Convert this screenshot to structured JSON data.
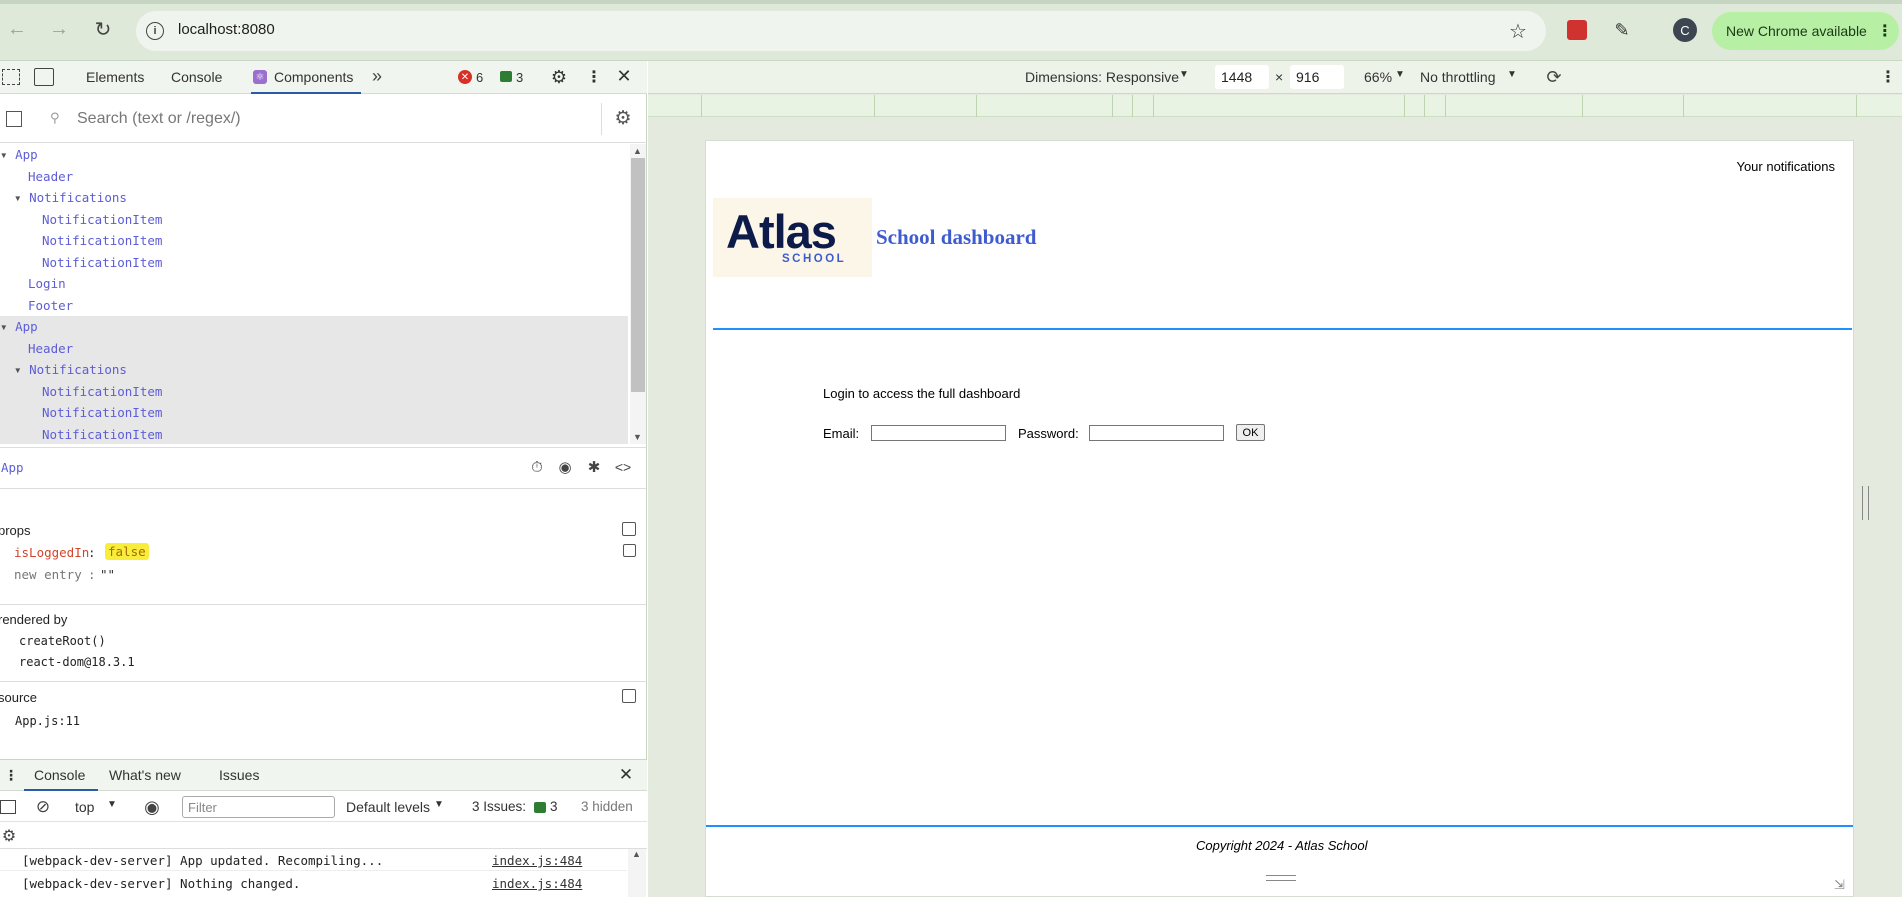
{
  "browser": {
    "url": "localhost:8080",
    "update_label": "New Chrome available",
    "profile_initial": "C"
  },
  "devtools": {
    "tabs": [
      "Elements",
      "Console",
      "Components"
    ],
    "error_count": "6",
    "warning_count": "3",
    "search_placeholder": "Search (text or /regex/)",
    "tree": [
      {
        "label": "App",
        "indent": 0,
        "expanded": true
      },
      {
        "label": "Header",
        "indent": 1
      },
      {
        "label": "Notifications",
        "indent": 1,
        "expanded": true
      },
      {
        "label": "NotificationItem",
        "indent": 2
      },
      {
        "label": "NotificationItem",
        "indent": 2
      },
      {
        "label": "NotificationItem",
        "indent": 2
      },
      {
        "label": "Login",
        "indent": 1
      },
      {
        "label": "Footer",
        "indent": 1
      },
      {
        "label": "App",
        "indent": 0,
        "expanded": true,
        "selected": true
      },
      {
        "label": "Header",
        "indent": 1,
        "selected": true
      },
      {
        "label": "Notifications",
        "indent": 1,
        "expanded": true,
        "selected": true
      },
      {
        "label": "NotificationItem",
        "indent": 2,
        "selected": true
      },
      {
        "label": "NotificationItem",
        "indent": 2,
        "selected": true
      },
      {
        "label": "NotificationItem",
        "indent": 2,
        "selected": true
      }
    ],
    "selected_component": "App",
    "props_title": "props",
    "prop_key": "isLoggedIn",
    "prop_value": "false",
    "new_entry_label": "new entry",
    "new_entry_value": "\"\"",
    "rendered_by_title": "rendered by",
    "rendered_by": [
      "createRoot()",
      "react-dom@18.3.1"
    ],
    "source_title": "source",
    "source_file": "App.js:11"
  },
  "drawer": {
    "tabs": [
      "Console",
      "What's new",
      "Issues"
    ],
    "context": "top",
    "filter_placeholder": "Filter",
    "levels": "Default levels",
    "issues_label": "3 Issues:",
    "issues_count": "3",
    "hidden": "3 hidden",
    "messages": [
      {
        "text": "[webpack-dev-server] App updated. Recompiling...",
        "source": "index.js:484"
      },
      {
        "text": "[webpack-dev-server] Nothing changed.",
        "source": "index.js:484"
      }
    ]
  },
  "device_toolbar": {
    "dimensions": "Dimensions: Responsive",
    "width": "1448",
    "height": "916",
    "zoom": "66%",
    "throttling": "No throttling"
  },
  "app": {
    "notifications_label": "Your notifications",
    "logo_main": "Atlas",
    "logo_sub": "SCHOOL",
    "title": "School dashboard",
    "login_prompt": "Login to access the full dashboard",
    "email_label": "Email:",
    "password_label": "Password:",
    "ok_label": "OK",
    "footer": "Copyright 2024 - Atlas School"
  },
  "colors": {
    "accent_blue": "#1e90ff",
    "title_blue": "#3f5bd0",
    "logo_navy": "#0d1b4b",
    "react_purple": "#5d5dd7"
  }
}
